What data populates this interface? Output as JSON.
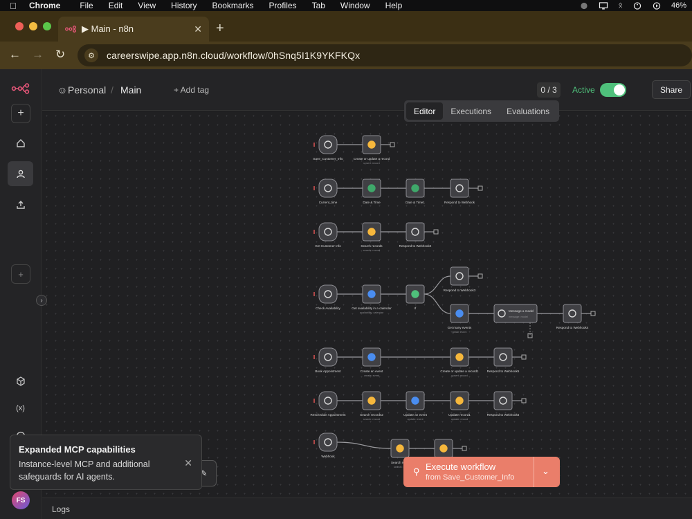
{
  "menubar": {
    "items": [
      "Chrome",
      "File",
      "Edit",
      "View",
      "History",
      "Bookmarks",
      "Profiles",
      "Tab",
      "Window",
      "Help"
    ],
    "battery": "46%"
  },
  "browser": {
    "tab_title": "▶ Main - n8n",
    "url": "careerswipe.app.n8n.cloud/workflow/0hSnq5I1K9YKFKQx"
  },
  "header": {
    "crumb_project": "Personal",
    "crumb_workflow": "Main",
    "add_tag": "+ Add tag",
    "counter": "0 / 3",
    "active_label": "Active",
    "share_label": "Share"
  },
  "view_tabs": [
    "Editor",
    "Executions",
    "Evaluations"
  ],
  "nodes": [
    {
      "label": "Save_Customer_Info",
      "sub": "",
      "kind": "trigger"
    },
    {
      "label": "Create or update a record",
      "sub": "upsert: record",
      "kind": "airtable"
    },
    {
      "label": "Current_time",
      "sub": "",
      "kind": "trigger"
    },
    {
      "label": "Date & Time",
      "sub": "",
      "kind": "clock"
    },
    {
      "label": "Date & Time1",
      "sub": "",
      "kind": "clock"
    },
    {
      "label": "Respond to Webhook",
      "sub": "",
      "kind": "webhook"
    },
    {
      "label": "Get Customer Info",
      "sub": "",
      "kind": "trigger"
    },
    {
      "label": "Search records",
      "sub": "search: record",
      "kind": "airtable"
    },
    {
      "label": "Respond to Webhook2",
      "sub": "",
      "kind": "webhook"
    },
    {
      "label": "Check Availability",
      "sub": "",
      "kind": "trigger"
    },
    {
      "label": "Get availability in a calendar",
      "sub": "availability: calendar",
      "kind": "calendar"
    },
    {
      "label": "If",
      "sub": "",
      "kind": "if"
    },
    {
      "label": "Respond to Webhook3",
      "sub": "",
      "kind": "webhook"
    },
    {
      "label": "Get many events",
      "sub": "getAll: event",
      "kind": "calendar"
    },
    {
      "label": "Message a model",
      "sub": "message: model",
      "kind": "openai"
    },
    {
      "label": "Respond to Webhook4",
      "sub": "",
      "kind": "webhook"
    },
    {
      "label": "Book Appointment",
      "sub": "",
      "kind": "trigger"
    },
    {
      "label": "Create an event",
      "sub": "create: event",
      "kind": "calendar"
    },
    {
      "label": "Create or update a record1",
      "sub": "upsert: record",
      "kind": "airtable"
    },
    {
      "label": "Respond to Webhook5",
      "sub": "",
      "kind": "webhook"
    },
    {
      "label": "Reschedule Appointment",
      "sub": "",
      "kind": "trigger"
    },
    {
      "label": "Search records2",
      "sub": "search: record",
      "kind": "airtable"
    },
    {
      "label": "Update an event",
      "sub": "update: event",
      "kind": "calendar"
    },
    {
      "label": "Update record1",
      "sub": "update: record",
      "kind": "airtable"
    },
    {
      "label": "Respond to Webhook6",
      "sub": "",
      "kind": "webhook"
    },
    {
      "label": "Webhook",
      "sub": "",
      "kind": "trigger"
    },
    {
      "label": "Search rec...",
      "sub": "search: r...",
      "kind": "airtable"
    },
    {
      "label": "",
      "sub": "",
      "kind": "airtable"
    }
  ],
  "toast": {
    "title": "Expanded MCP capabilities",
    "body": "Instance-level MCP and additional safeguards for AI agents."
  },
  "execute": {
    "label": "Execute workflow",
    "from": "from Save_Customer_Info"
  },
  "logs_label": "Logs",
  "avatar_initials": "FS",
  "colors": {
    "accent": "#ea7e6a",
    "active": "#4fc07b",
    "tabbar": "#4a3c1d"
  }
}
